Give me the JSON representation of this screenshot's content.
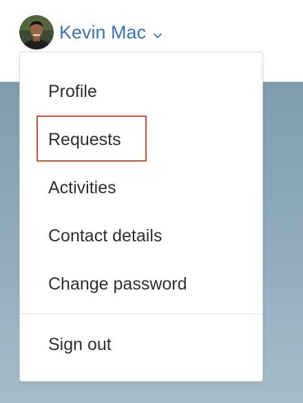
{
  "header": {
    "user_name": "Kevin Mac",
    "avatar_icon": "avatar-photo",
    "dropdown_icon": "chevron-down-icon",
    "accent_color": "#3a73b3"
  },
  "menu": {
    "items": [
      {
        "label": "Profile"
      },
      {
        "label": "Requests"
      },
      {
        "label": "Activities"
      },
      {
        "label": "Contact details"
      },
      {
        "label": "Change password"
      }
    ],
    "sign_out": {
      "label": "Sign out"
    },
    "highlighted_item": "Requests",
    "highlight_color": "#dd4b34"
  }
}
